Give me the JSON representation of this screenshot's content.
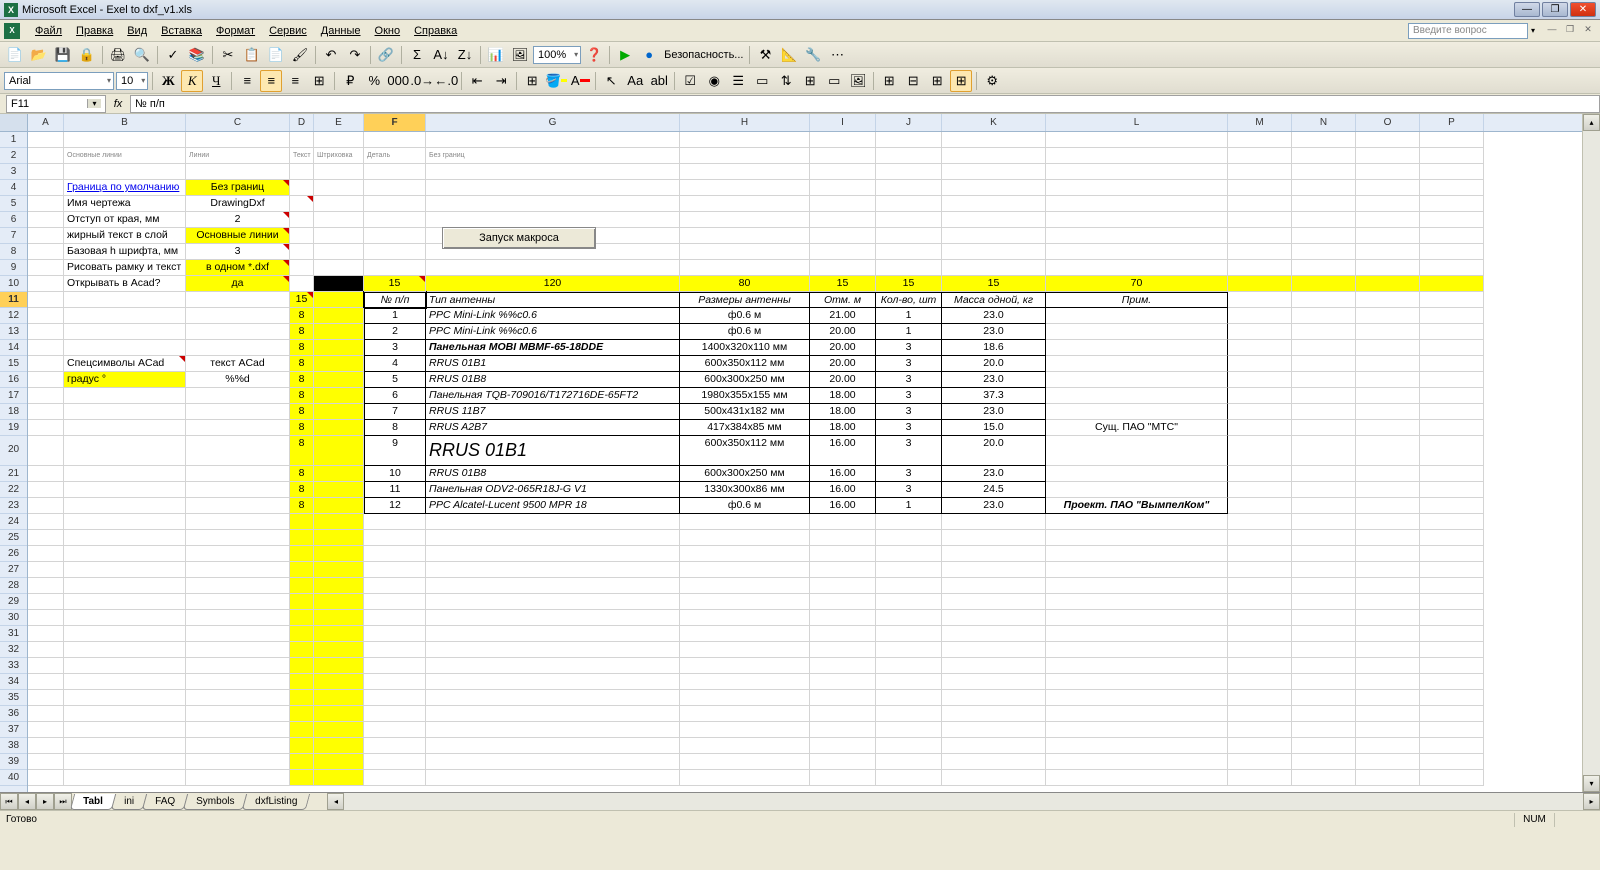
{
  "title": "Microsoft Excel - Exel to dxf_v1.xls",
  "menu": [
    "Файл",
    "Правка",
    "Вид",
    "Вставка",
    "Формат",
    "Сервис",
    "Данные",
    "Окно",
    "Справка"
  ],
  "question_placeholder": "Введите вопрос",
  "font_name": "Arial",
  "font_size": "10",
  "zoom": "100%",
  "security_label": "Безопасность...",
  "name_box": "F11",
  "formula": "№ п/п",
  "macro_button": "Запуск макроса",
  "row2_labels": [
    "Основные линии",
    "Линии",
    "Текст",
    "Штриховка",
    "Деталь",
    "Без границ"
  ],
  "settings": [
    {
      "label": "Граница по умолчанию",
      "value": "Без границ",
      "link": true,
      "yellow": true,
      "tri": true
    },
    {
      "label": "Имя чертежа",
      "value": "DrawingDxf",
      "tri_right": true
    },
    {
      "label": "Отступ от края, мм",
      "value": "2",
      "tri": true
    },
    {
      "label": "жирный текст в слой",
      "value": "Основные линии",
      "yellow": true,
      "tri": true
    },
    {
      "label": "Базовая h шрифта, мм",
      "value": "3",
      "tri": true
    },
    {
      "label": "Рисовать рамку и текст",
      "value": "в одном *.dxf",
      "yellow": true,
      "tri": true
    },
    {
      "label": "Открывать в Acad?",
      "value": "да",
      "yellow": true,
      "tri": true
    }
  ],
  "spec_label": "Спецсимволы ACad",
  "spec_col2": "текст ACad",
  "degree_label": "градус °",
  "degree_val": "%%d",
  "col_widths": [
    "15",
    "120",
    "80",
    "15",
    "15",
    "15",
    "70"
  ],
  "d_col": [
    "15",
    "8",
    "8",
    "8",
    "8",
    "8",
    "8",
    "8",
    "8",
    "8",
    "8",
    "8",
    "8"
  ],
  "headers": [
    "№ п/п",
    "Тип антенны",
    "Размеры антенны",
    "Отм. м",
    "Кол-во, шт",
    "Масса одной, кг",
    "Прим."
  ],
  "rows": [
    {
      "n": "1",
      "type": "PPC Mini-Link %%c0.6",
      "dim": "ф0.6 м",
      "elev": "21.00",
      "qty": "1",
      "mass": "23.0"
    },
    {
      "n": "2",
      "type": "PPC Mini-Link %%c0.6",
      "dim": "ф0.6 м",
      "elev": "20.00",
      "qty": "1",
      "mass": "23.0"
    },
    {
      "n": "3",
      "type": "Панельная MOBI MBMF-65-18DDE",
      "dim": "1400x320x110 мм",
      "elev": "20.00",
      "qty": "3",
      "mass": "18.6",
      "bold": true
    },
    {
      "n": "4",
      "type": "RRUS 01B1",
      "dim": "600x350x112 мм",
      "elev": "20.00",
      "qty": "3",
      "mass": "20.0"
    },
    {
      "n": "5",
      "type": "RRUS 01B8",
      "dim": "600x300x250 мм",
      "elev": "20.00",
      "qty": "3",
      "mass": "23.0"
    },
    {
      "n": "6",
      "type": "Панельная TQB-709016/T172716DE-65FT2",
      "dim": "1980x355x155 мм",
      "elev": "18.00",
      "qty": "3",
      "mass": "37.3"
    },
    {
      "n": "7",
      "type": "RRUS 11B7",
      "dim": "500x431x182 мм",
      "elev": "18.00",
      "qty": "3",
      "mass": "23.0"
    },
    {
      "n": "8",
      "type": "RRUS A2B7",
      "dim": "417x384x85 мм",
      "elev": "18.00",
      "qty": "3",
      "mass": "15.0"
    },
    {
      "n": "9",
      "type": "RRUS 01B1",
      "dim": "600x350x112 мм",
      "elev": "16.00",
      "qty": "3",
      "mass": "20.0",
      "big": true
    },
    {
      "n": "10",
      "type": "RRUS 01B8",
      "dim": "600x300x250 мм",
      "elev": "16.00",
      "qty": "3",
      "mass": "23.0"
    },
    {
      "n": "11",
      "type": "Панельная ODV2-065R18J-G V1",
      "dim": "1330x300x86 мм",
      "elev": "16.00",
      "qty": "3",
      "mass": "24.5"
    },
    {
      "n": "12",
      "type": "PPC Alcatel-Lucent 9500 MPR 18",
      "dim": "ф0.6 м",
      "elev": "16.00",
      "qty": "1",
      "mass": "23.0"
    }
  ],
  "note1": "Сущ. ПАО \"МТС\"",
  "note2": "Проект. ПАО \"ВымпелКом\"",
  "tabs": [
    "Tabl",
    "ini",
    "FAQ",
    "Symbols",
    "dxfListing"
  ],
  "status": "Готово",
  "num_ind": "NUM",
  "columns": [
    "A",
    "B",
    "C",
    "D",
    "E",
    "F",
    "G",
    "H",
    "I",
    "J",
    "K",
    "L",
    "M",
    "N",
    "O",
    "P"
  ]
}
